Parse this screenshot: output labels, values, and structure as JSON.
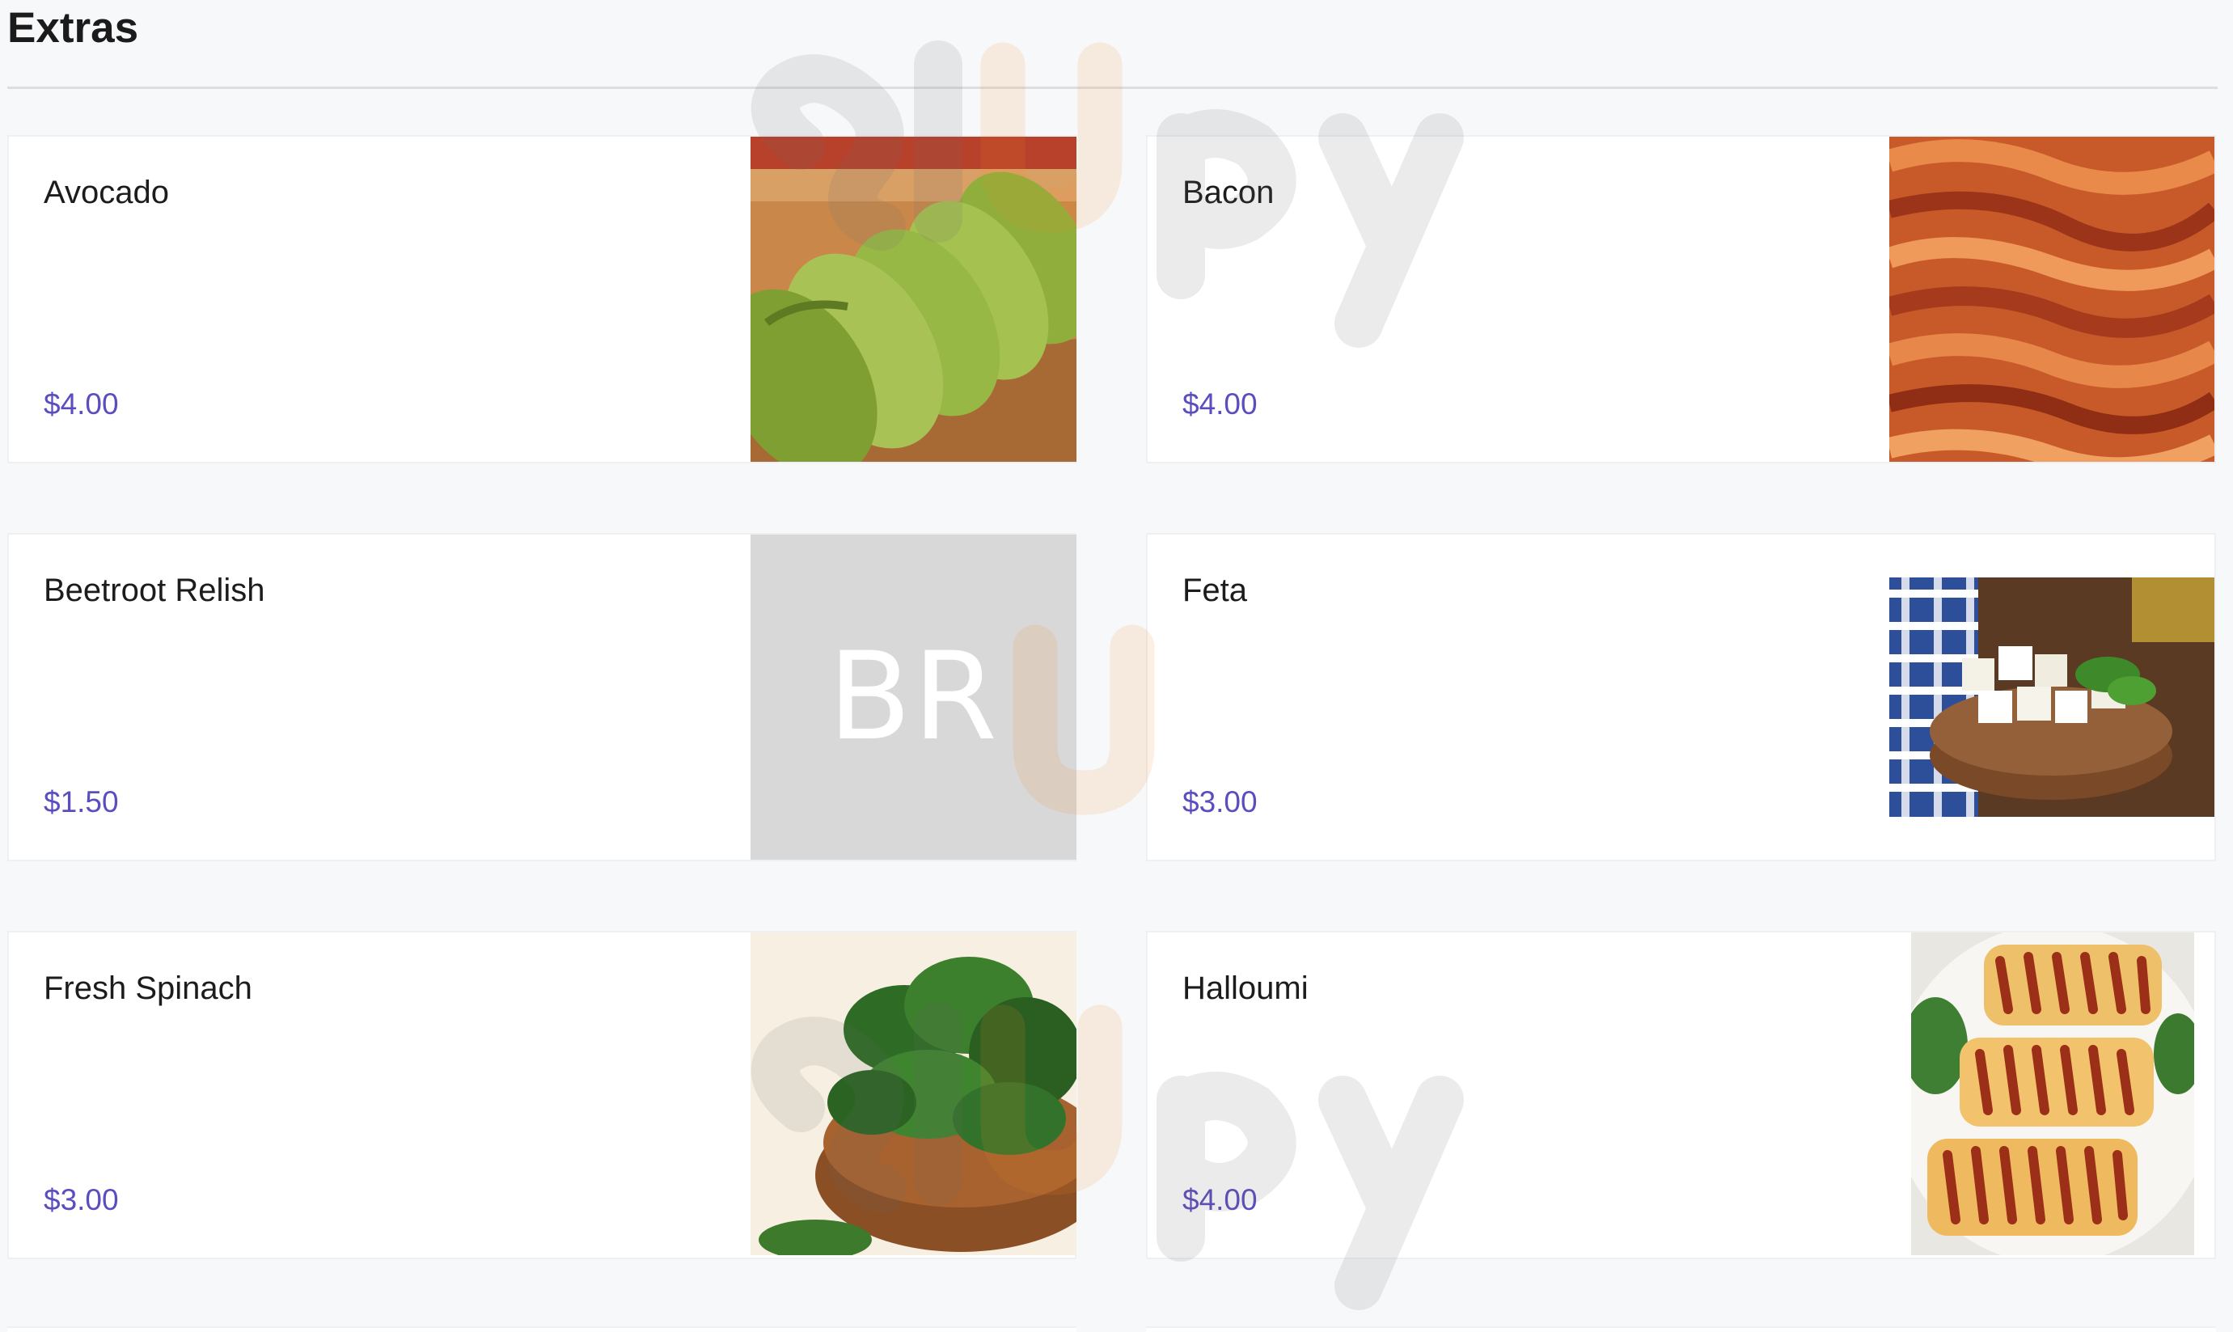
{
  "section": {
    "title": "Extras"
  },
  "items": [
    {
      "name": "Avocado",
      "price": "$4.00",
      "image": "avocado-photo"
    },
    {
      "name": "Bacon",
      "price": "$4.00",
      "image": "bacon-photo"
    },
    {
      "name": "Beetroot Relish",
      "price": "$1.50",
      "image": "placeholder",
      "initials": "BR"
    },
    {
      "name": "Feta",
      "price": "$3.00",
      "image": "feta-photo"
    },
    {
      "name": "Fresh Spinach",
      "price": "$3.00",
      "image": "spinach-photo"
    },
    {
      "name": "Halloumi",
      "price": "$4.00",
      "image": "halloumi-photo"
    }
  ],
  "colors": {
    "price": "#5a4dc0",
    "background": "#f7f8fa",
    "card": "#ffffff",
    "placeholder": "#d8d8d8"
  }
}
